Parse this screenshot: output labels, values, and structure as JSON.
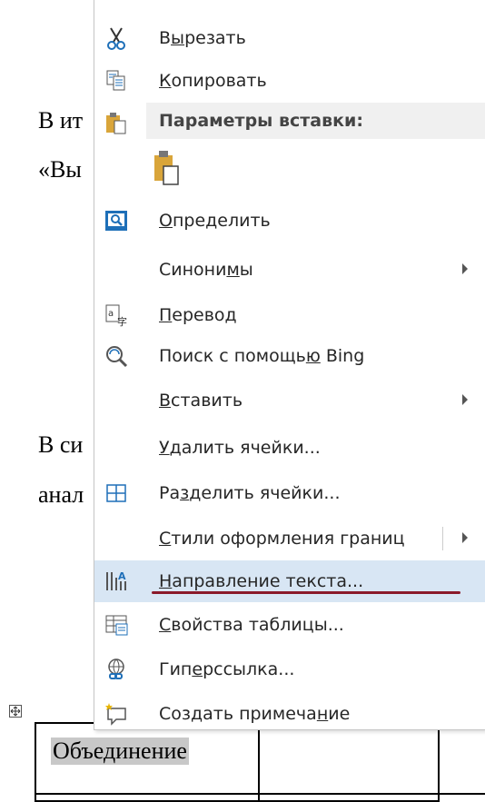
{
  "document": {
    "lines": [
      "В ит",
      "«Вы",
      "В си",
      "анал"
    ],
    "table_cell_text": "Объединение"
  },
  "menu": {
    "items": [
      {
        "id": "cut",
        "pre": "В",
        "u": "ы",
        "post": "резать",
        "icon": "scissors-icon"
      },
      {
        "id": "copy",
        "pre": "",
        "u": "К",
        "post": "опировать",
        "icon": "copy-icon"
      },
      {
        "id": "define",
        "pre": "",
        "u": "О",
        "post": "пределить",
        "icon": "define-icon"
      },
      {
        "id": "synonyms",
        "pre": "Синони",
        "u": "м",
        "post": "ы",
        "icon": "",
        "submenu": true
      },
      {
        "id": "translate",
        "pre": "",
        "u": "П",
        "post": "еревод",
        "icon": "translate-icon"
      },
      {
        "id": "bing",
        "pre": "Поиск с помощь",
        "u": "ю",
        "post": " Bing",
        "icon": "bing-search-icon"
      },
      {
        "id": "insert",
        "pre": "",
        "u": "В",
        "post": "ставить",
        "icon": "",
        "submenu": true
      },
      {
        "id": "delete-cells",
        "pre": "",
        "u": "У",
        "post": "далить ячейки...",
        "icon": ""
      },
      {
        "id": "split-cells",
        "pre": "Ра",
        "u": "з",
        "post": "делить ячейки...",
        "icon": "split-cells-icon"
      },
      {
        "id": "border-styles",
        "pre": "",
        "u": "С",
        "post": "тили оформления границ",
        "icon": "",
        "submenu": true
      },
      {
        "id": "text-direction",
        "pre": "",
        "u": "Н",
        "post": "аправление текста...",
        "icon": "text-direction-icon"
      },
      {
        "id": "table-properties",
        "pre": "",
        "u": "С",
        "post": "войства таблицы...",
        "icon": "table-properties-icon"
      },
      {
        "id": "hyperlink",
        "pre": "Гип",
        "u": "е",
        "post": "рссылка...",
        "icon": "hyperlink-icon"
      },
      {
        "id": "new-comment",
        "pre": "Создать примеча",
        "u": "н",
        "post": "ие",
        "icon": "new-comment-icon"
      }
    ],
    "paste_header": "Параметры вставки:",
    "paste_option_icon": "paste-keep-text-icon",
    "colors": {
      "hover": "#d8e6f4",
      "underline": "#8b1a2a",
      "icon_blue": "#1e6fb8",
      "icon_orange": "#d9a53a"
    }
  }
}
